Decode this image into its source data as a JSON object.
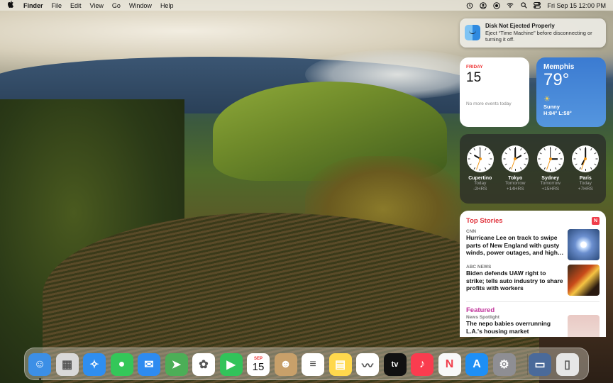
{
  "menubar": {
    "apple_icon": "apple-logo-icon",
    "app_name": "Finder",
    "menus": [
      "File",
      "Edit",
      "View",
      "Go",
      "Window",
      "Help"
    ],
    "status_icons": [
      "time-machine-icon",
      "account-icon",
      "screen-record-icon",
      "wifi-icon",
      "search-icon",
      "control-center-icon"
    ],
    "clock": "Fri Sep 15  12:00 PM"
  },
  "notification": {
    "title": "Disk Not Ejected Properly",
    "body": "Eject “Time Machine” before disconnecting or turning it off.",
    "icon": "finder-icon"
  },
  "calendar_widget": {
    "weekday": "FRIDAY",
    "date": "15",
    "events_text": "No more events today"
  },
  "weather_widget": {
    "city": "Memphis",
    "temperature": "79°",
    "condition_icon": "sun-icon",
    "condition": "Sunny",
    "high_low": "H:84° L:58°",
    "color": "#3b7bd1"
  },
  "world_clock": [
    {
      "city": "Cupertino",
      "day": "Today",
      "offset": "-2HRS",
      "hour": 10,
      "minute": 0
    },
    {
      "city": "Tokyo",
      "day": "Tomorrow",
      "offset": "+14HRS",
      "hour": 2,
      "minute": 0
    },
    {
      "city": "Sydney",
      "day": "Tomorrow",
      "offset": "+15HRS",
      "hour": 3,
      "minute": 0
    },
    {
      "city": "Paris",
      "day": "Today",
      "offset": "+7HRS",
      "hour": 7,
      "minute": 0
    }
  ],
  "news_widget": {
    "section_title": "Top Stories",
    "logo_icon": "news-icon",
    "stories": [
      {
        "source": "CNN",
        "headline": "Hurricane Lee on track to swipe parts of New England with gusty winds, power outages, and high…"
      },
      {
        "source": "ABC NEWS",
        "headline": "Biden defends UAW right to strike; tells auto industry to share profits with workers"
      }
    ],
    "featured_title": "Featured",
    "featured_source": "News Spotlight",
    "featured_headline": "The nepo babies overrunning L.A.'s housing market"
  },
  "dock": {
    "apps": [
      {
        "name": "Finder",
        "icon": "finder-icon",
        "color": "#3c8fe6",
        "running": true
      },
      {
        "name": "Launchpad",
        "icon": "launchpad-icon",
        "color": "#d9d9d9"
      },
      {
        "name": "Safari",
        "icon": "safari-icon",
        "color": "#2f8ef0"
      },
      {
        "name": "Messages",
        "icon": "messages-icon",
        "color": "#34c759"
      },
      {
        "name": "Mail",
        "icon": "mail-icon",
        "color": "#2e8bf0"
      },
      {
        "name": "Maps",
        "icon": "maps-icon",
        "color": "#4cae57"
      },
      {
        "name": "Photos",
        "icon": "photos-icon",
        "color": "#ffffff"
      },
      {
        "name": "FaceTime",
        "icon": "facetime-icon",
        "color": "#32c35a"
      },
      {
        "name": "Calendar",
        "icon": "calendar-icon",
        "color": "#ffffff",
        "month": "SEP",
        "day": "15"
      },
      {
        "name": "Contacts",
        "icon": "contacts-icon",
        "color": "#c8a06a"
      },
      {
        "name": "Reminders",
        "icon": "reminders-icon",
        "color": "#ffffff"
      },
      {
        "name": "Notes",
        "icon": "notes-icon",
        "color": "#ffd84d"
      },
      {
        "name": "Freeform",
        "icon": "freeform-icon",
        "color": "#ffffff"
      },
      {
        "name": "Apple TV",
        "icon": "tv-icon",
        "color": "#111111",
        "label": "tv"
      },
      {
        "name": "Music",
        "icon": "music-icon",
        "color": "#fa3c4f"
      },
      {
        "name": "News",
        "icon": "news-icon",
        "color": "#f8f8f8"
      },
      {
        "name": "App Store",
        "icon": "app-store-icon",
        "color": "#1e8ff5"
      },
      {
        "name": "System Settings",
        "icon": "gear-icon",
        "color": "#8e8e93"
      },
      {
        "name": "Downloads",
        "icon": "folder-stack-icon",
        "color": "#4a6a9a"
      },
      {
        "name": "Trash",
        "icon": "trash-icon",
        "color": "#e6e6e6"
      }
    ]
  }
}
